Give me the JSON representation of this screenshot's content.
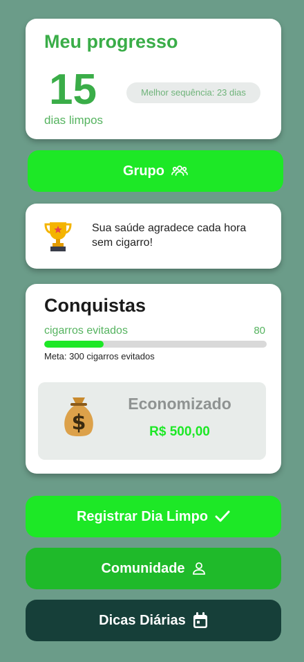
{
  "colors": {
    "background": "#6b9c89",
    "accent_green": "#1de826",
    "community_green": "#1fba2a",
    "tips_dark": "#163f39",
    "title_green": "#3aad48"
  },
  "progress": {
    "title": "Meu progresso",
    "days_count": "15",
    "days_label": "dias limpos",
    "best_streak": "Melhor sequência: 23 dias"
  },
  "group_button": {
    "label": "Grupo",
    "icon": "group-icon"
  },
  "motivation": {
    "icon": "trophy-icon",
    "text": "Sua saúde agradece cada hora sem cigarro!"
  },
  "achievements": {
    "title": "Conquistas",
    "cigarettes_label": "cigarros evitados",
    "cigarettes_value": "80",
    "cigarettes_progress": 0.267,
    "goal_text": "Meta: 300 cigarros evitados",
    "savings": {
      "icon": "money-bag-icon",
      "title": "Economizado",
      "value": "R$ 500,00"
    }
  },
  "actions": {
    "register_label": "Registrar Dia Limpo",
    "register_icon": "checkmark-icon",
    "community_label": "Comunidade",
    "community_icon": "person-icon",
    "tips_label": "Dicas Diárias",
    "tips_icon": "calendar-icon"
  }
}
